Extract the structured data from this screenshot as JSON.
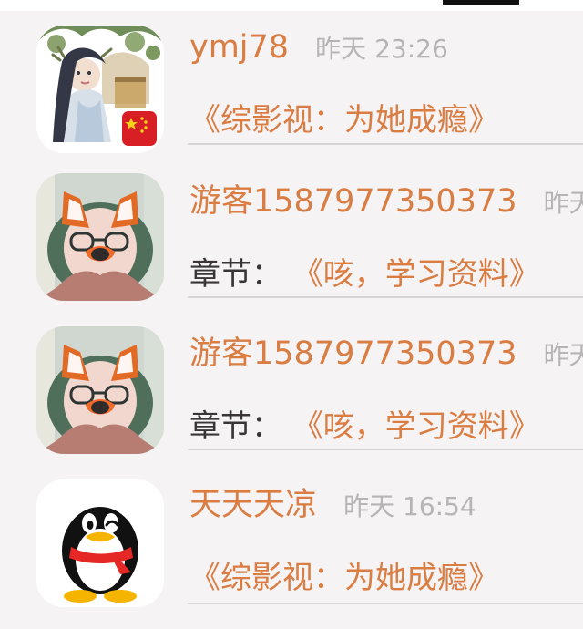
{
  "comments": [
    {
      "username": "ymj78",
      "time": "昨天 23:26",
      "prefix": "",
      "title": "《综影视：为她成瘾》",
      "avatar_icon": "illustrated-girl-avatar-icon",
      "badge_icon": "china-flag-icon"
    },
    {
      "username": "游客1587977350373",
      "time": "昨天",
      "prefix": "章节：",
      "title": "《咳，学习资料》",
      "avatar_icon": "fox-filter-avatar-icon"
    },
    {
      "username": "游客1587977350373",
      "time": "昨天",
      "prefix": "章节：",
      "title": "《咳，学习资料》",
      "avatar_icon": "fox-filter-avatar-icon"
    },
    {
      "username": "天天天凉",
      "time": "昨天 16:54",
      "prefix": "",
      "title": "《综影视：为她成瘾》",
      "avatar_icon": "qq-penguin-avatar-icon"
    }
  ],
  "colors": {
    "background": "#f6f3f4",
    "username": "#d97d43",
    "time": "#b8b4b5",
    "prefix_text": "#3a3637",
    "title_text": "#d97d43",
    "divider": "#d8d4d5"
  }
}
